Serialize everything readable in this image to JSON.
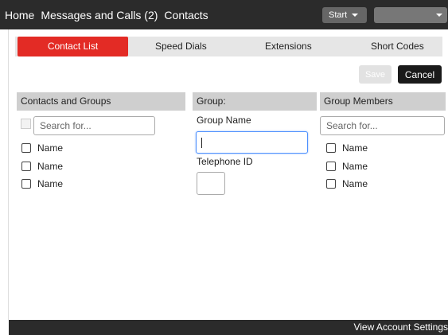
{
  "topbar": {
    "nav": [
      "Home",
      "Messages and Calls (2)",
      "Contacts"
    ],
    "start_label": "Start",
    "user_dropdown_value": ""
  },
  "tabs": [
    "Contact List",
    "Speed Dials",
    "Extensions",
    "Short Codes"
  ],
  "actions": {
    "save_label": "Save",
    "cancel_label": "Cancel"
  },
  "contacts_panel": {
    "header": "Contacts and Groups",
    "search_placeholder": "Search for...",
    "items": [
      "Name",
      "Name",
      "Name"
    ]
  },
  "group_panel": {
    "header": "Group:",
    "group_name_label": "Group Name",
    "group_name_value": "",
    "telephone_id_label": "Telephone ID",
    "telephone_id_value": ""
  },
  "members_panel": {
    "header": "Group Members",
    "search_placeholder": "Search for...",
    "items": [
      "Name",
      "Name",
      "Name"
    ]
  },
  "footer": {
    "link_label": "View Account Settings"
  },
  "colors": {
    "accent": "#e32b25",
    "bar": "#2b2b2b",
    "header_bg": "#cfcfcf"
  }
}
